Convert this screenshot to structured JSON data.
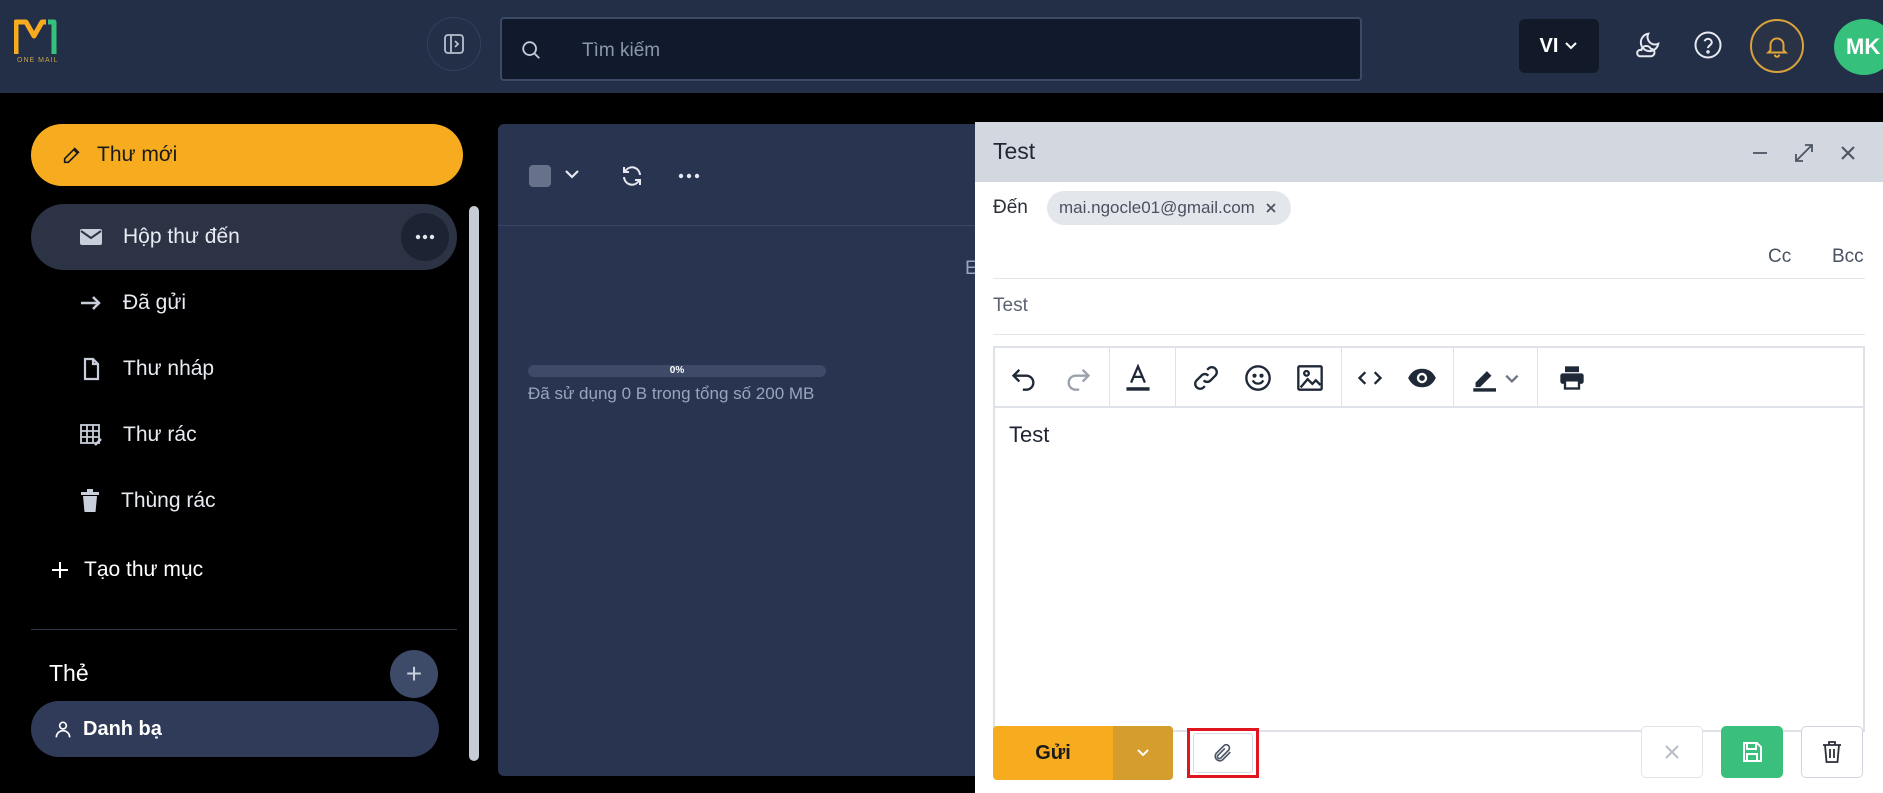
{
  "app": {
    "logo_letters": "M1",
    "logo_text": "ONE MAIL",
    "brand_color": "#f6ac1e"
  },
  "header": {
    "search_placeholder": "Tìm kiếm",
    "language": "VI",
    "avatar_initials": "MK"
  },
  "sidebar": {
    "compose_label": "Thư mới",
    "items": [
      {
        "label": "Hộp thư đến",
        "icon": "mail-icon",
        "active": true
      },
      {
        "label": "Đã gửi",
        "icon": "arrow-right-icon"
      },
      {
        "label": "Thư nháp",
        "icon": "document-icon"
      },
      {
        "label": "Thư rác",
        "icon": "spam-icon"
      },
      {
        "label": "Thùng rác",
        "icon": "trash-icon"
      }
    ],
    "create_folder_label": "Tạo thư mục",
    "tags_title": "Thẻ",
    "contacts_label": "Danh bạ"
  },
  "mail_list": {
    "quota_percent": "0%",
    "quota_fraction": 0,
    "quota_text": "Đã sử dụng 0 B trong tổng số 200 MB",
    "partial_text": "E"
  },
  "compose": {
    "title": "Test",
    "to_label": "Đến",
    "recipient": "mai.ngocle01@gmail.com",
    "cc_label": "Cc",
    "bcc_label": "Bcc",
    "subject": "Test",
    "body": "Test",
    "send_label": "Gửi",
    "highlight_color": "#e0151d"
  }
}
